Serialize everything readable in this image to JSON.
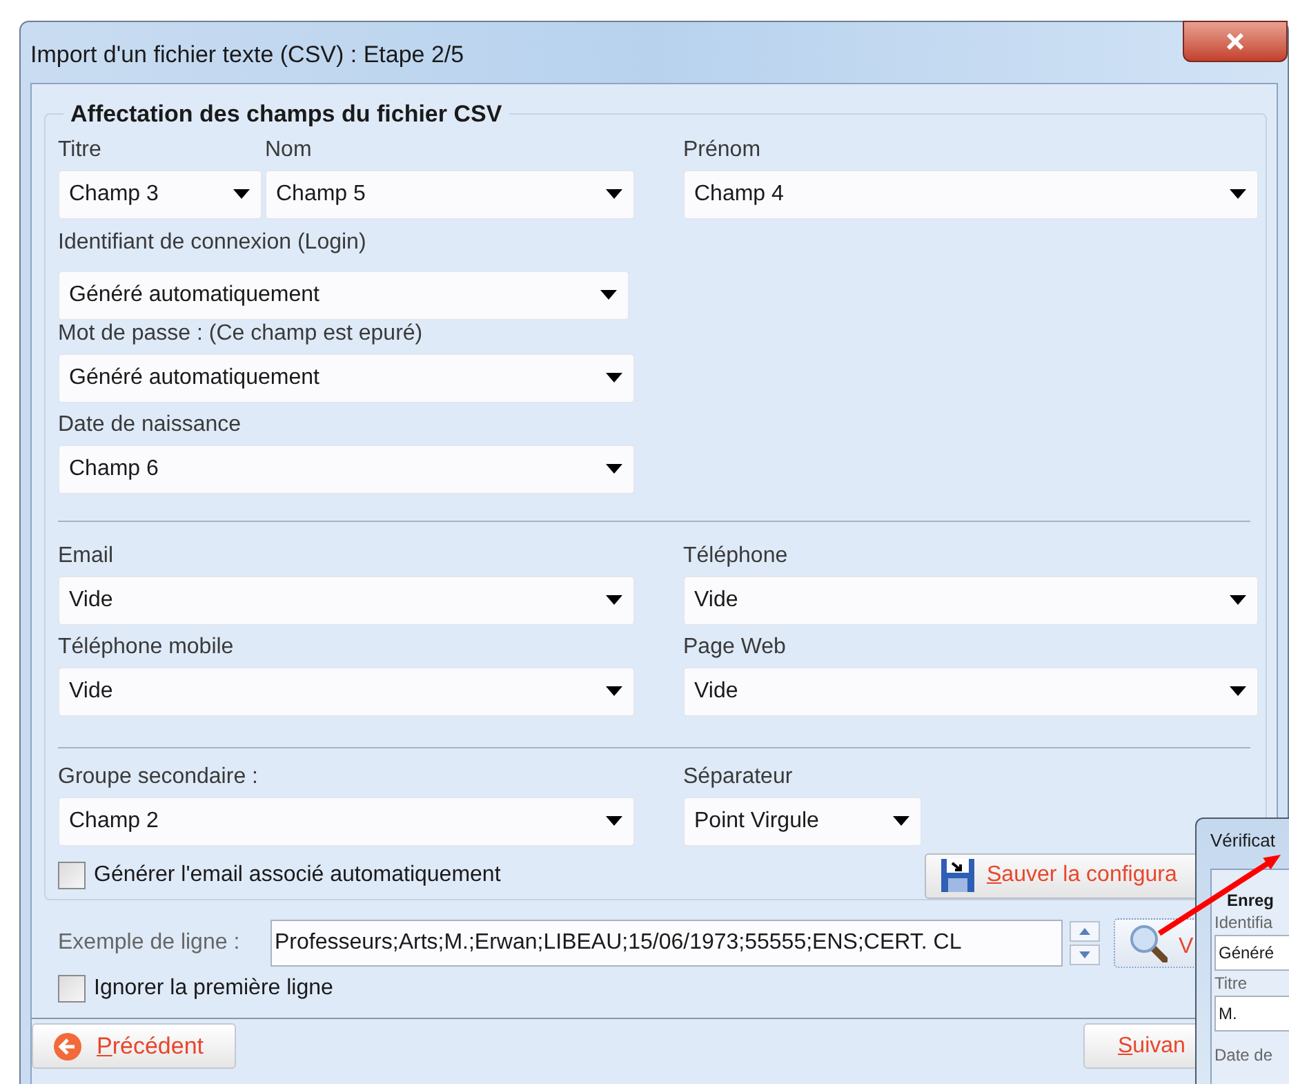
{
  "window": {
    "title": "Import d'un fichier texte (CSV) : Etape 2/5"
  },
  "group": {
    "title": "Affectation des champs du fichier CSV"
  },
  "name_fields": [
    {
      "label": "Titre",
      "value": "Champ 3"
    },
    {
      "label": "Nom",
      "value": "Champ 5"
    },
    {
      "label": "Prénom",
      "value": "Champ 4"
    }
  ],
  "left_fields": [
    {
      "label": "Identifiant de connexion (Login)",
      "value": "Généré automatiquement"
    },
    {
      "label": "Mot de passe : (Ce champ est epuré)",
      "value": "Généré automatiquement"
    },
    {
      "label": "Date de naissance",
      "value": "Champ 6"
    }
  ],
  "contact_fields": [
    {
      "label": "Email",
      "value": "Vide"
    },
    {
      "label": "Téléphone",
      "value": "Vide"
    },
    {
      "label": "Téléphone mobile",
      "value": "Vide"
    },
    {
      "label": "Page Web",
      "value": "Vide"
    }
  ],
  "group_field": {
    "label": "Groupe secondaire :",
    "value": "Champ 2"
  },
  "separator_field": {
    "label": "Séparateur",
    "value": "Point Virgule"
  },
  "generate_email": {
    "label": "Générer l'email associé automatiquement",
    "checked": false
  },
  "save_button": {
    "label": "Sauver la configura"
  },
  "sample": {
    "label": "Exemple de ligne :",
    "value": "Professeurs;Arts;M.;Erwan;LIBEAU;15/06/1973;55555;ENS;CERT. CL"
  },
  "view_button": {
    "label": "V"
  },
  "ignore_first_line": {
    "label": "Ignorer la première ligne",
    "checked": false
  },
  "prev_button": {
    "label": "Précédent"
  },
  "next_button": {
    "label": "Suivan"
  },
  "overlay_window": {
    "title": "Vérificat",
    "group_title": "Enreg",
    "fields": [
      {
        "label": "Identifia",
        "value": "Généré"
      },
      {
        "label": "Titre",
        "value": "M."
      }
    ],
    "trailing_label": "Date de"
  }
}
